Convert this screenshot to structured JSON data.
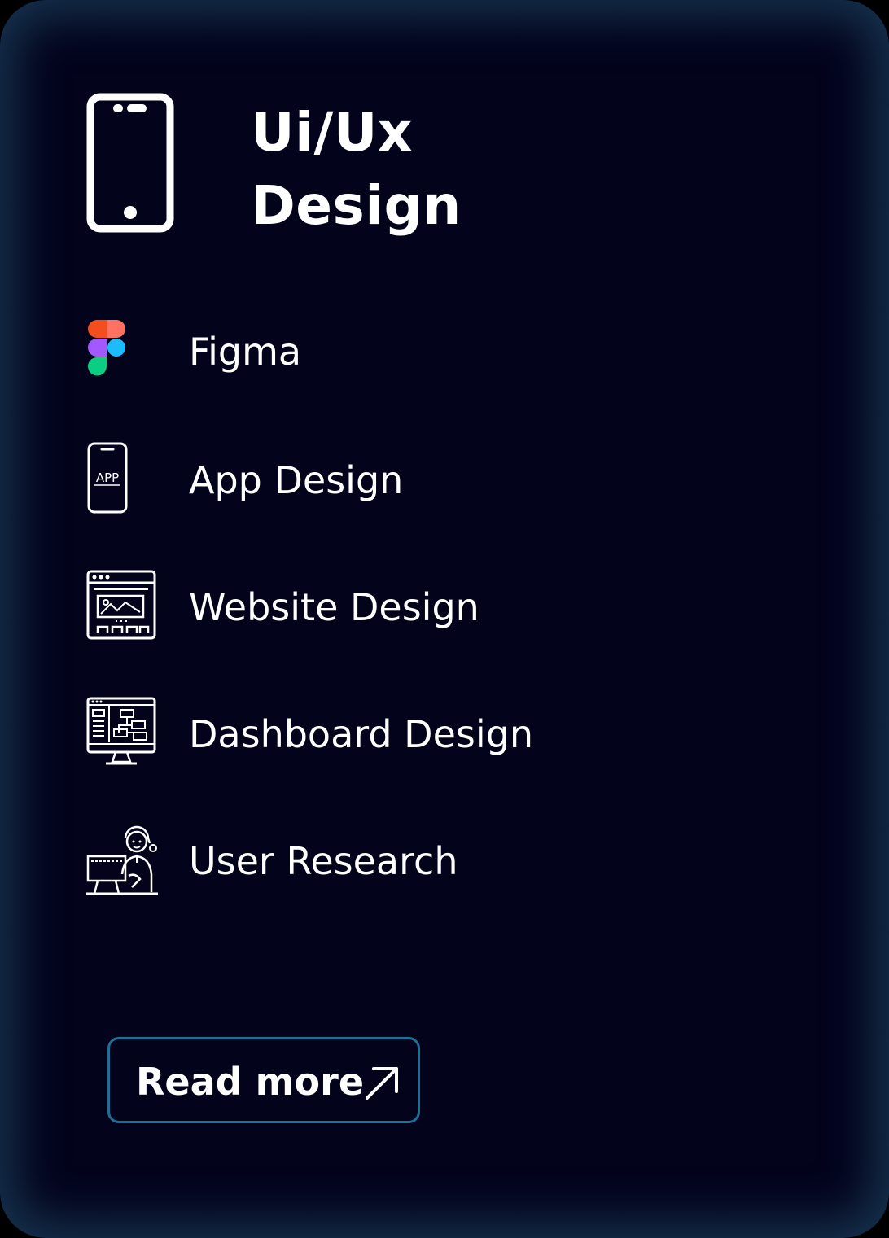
{
  "card": {
    "title_line1": "Ui/Ux",
    "title_line2": "Design",
    "header_icon": "smartphone-icon"
  },
  "services": [
    {
      "label": "Figma",
      "icon": "figma-icon"
    },
    {
      "label": "App Design",
      "icon": "app-phone-icon",
      "icon_text": "APP"
    },
    {
      "label": "Website Design",
      "icon": "website-icon"
    },
    {
      "label": "Dashboard Design",
      "icon": "dashboard-monitor-icon"
    },
    {
      "label": "User Research",
      "icon": "user-research-icon"
    }
  ],
  "cta": {
    "label": "Read more",
    "icon": "arrow-up-right-icon"
  },
  "colors": {
    "card_background": "#03031c",
    "glow": "#285c78",
    "button_border": "#1f6f96",
    "text": "#ffffff",
    "figma_red": "#f24e1e",
    "figma_orange": "#ff7262",
    "figma_purple": "#a259ff",
    "figma_blue": "#1abcfe",
    "figma_green": "#0acf83"
  }
}
